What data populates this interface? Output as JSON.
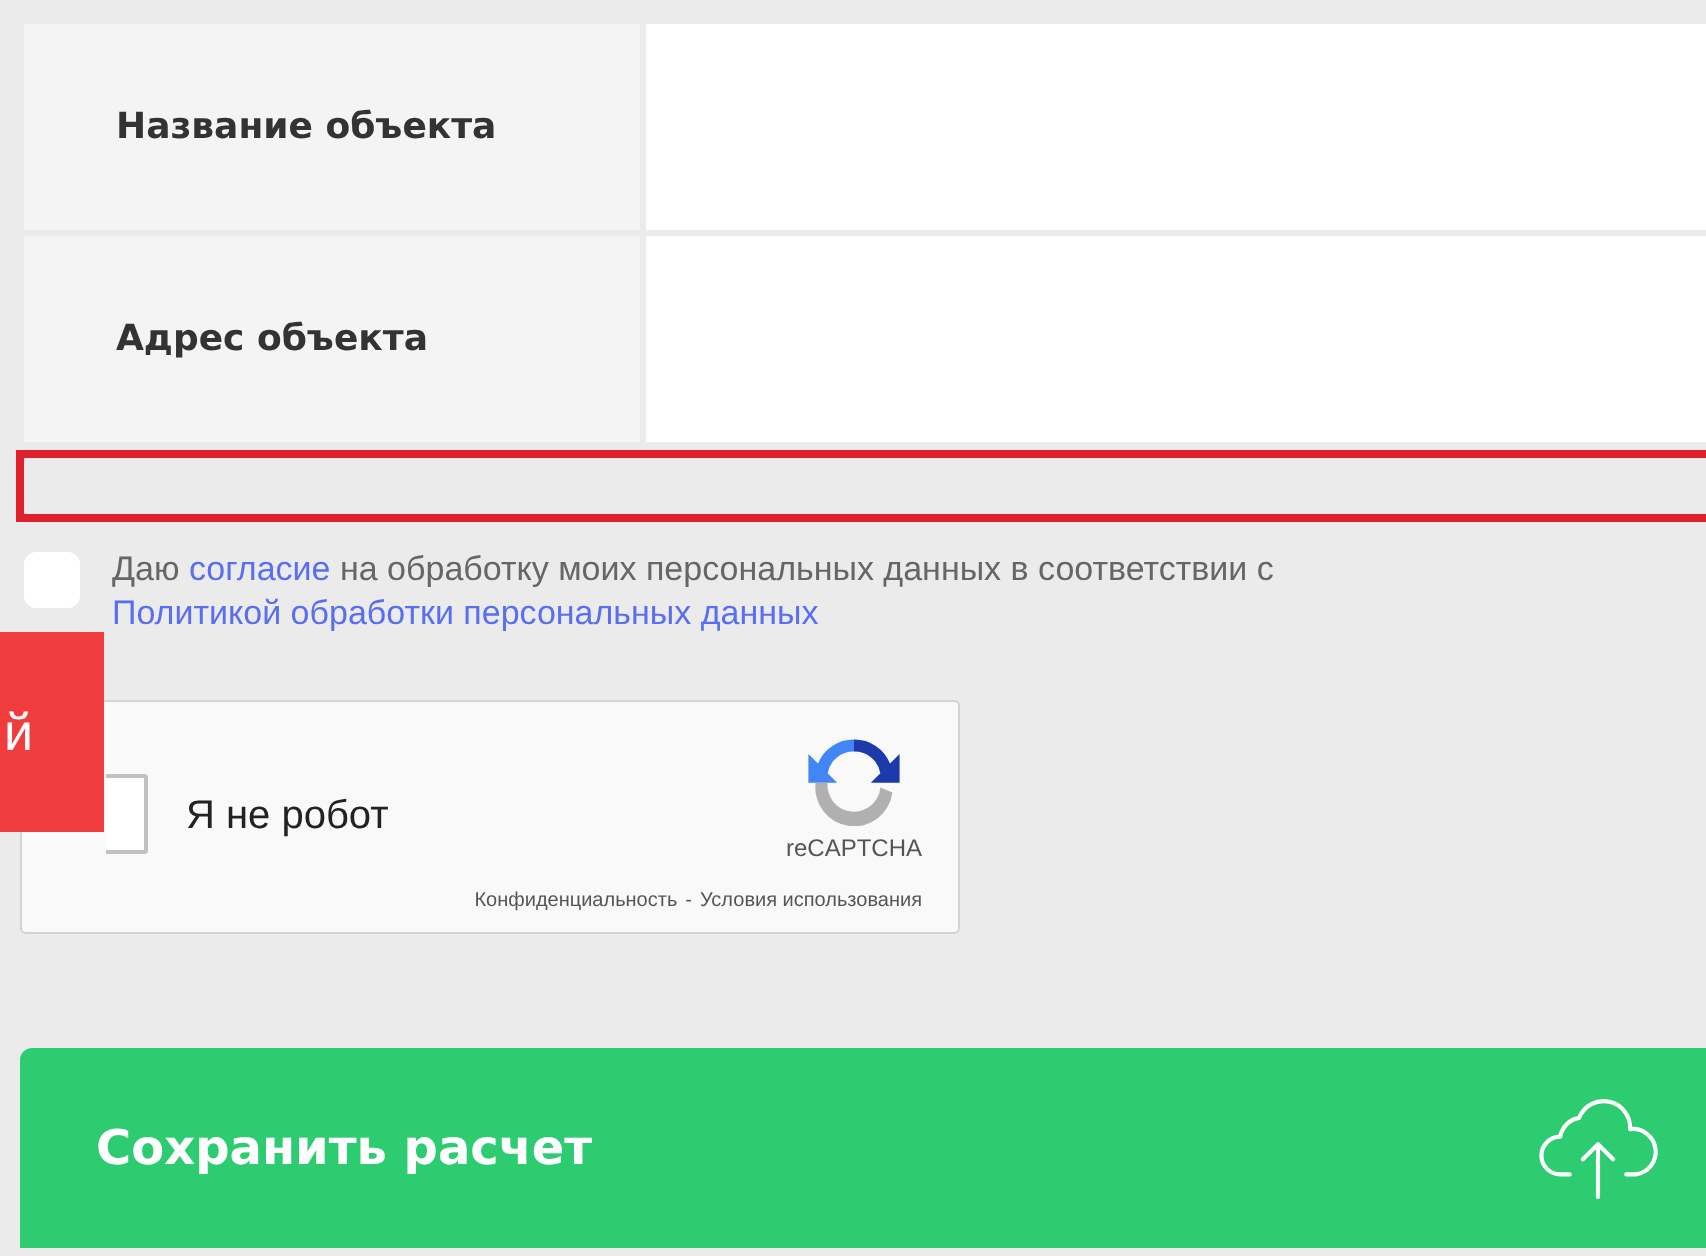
{
  "fields": [
    {
      "label": "Название объекта"
    },
    {
      "label": "Адрес объекта"
    }
  ],
  "error_field": {
    "invalid": true
  },
  "consent": {
    "checked": false,
    "parts": [
      {
        "text": "Даю ",
        "link": false
      },
      {
        "text": "согласие",
        "link": true
      },
      {
        "text": " на обработку моих персональных данных в соответствии с ",
        "link": false
      },
      {
        "text": "Политикой обработки персональных данных",
        "link": true
      }
    ]
  },
  "side_tab": {
    "text": "й"
  },
  "captcha": {
    "checked": false,
    "label": "Я не робот",
    "brand": "reCAPTCHA",
    "privacy": "Конфиденциальность",
    "separator": "-",
    "terms": "Условия использования"
  },
  "save_button": {
    "label": "Сохранить расчет"
  }
}
